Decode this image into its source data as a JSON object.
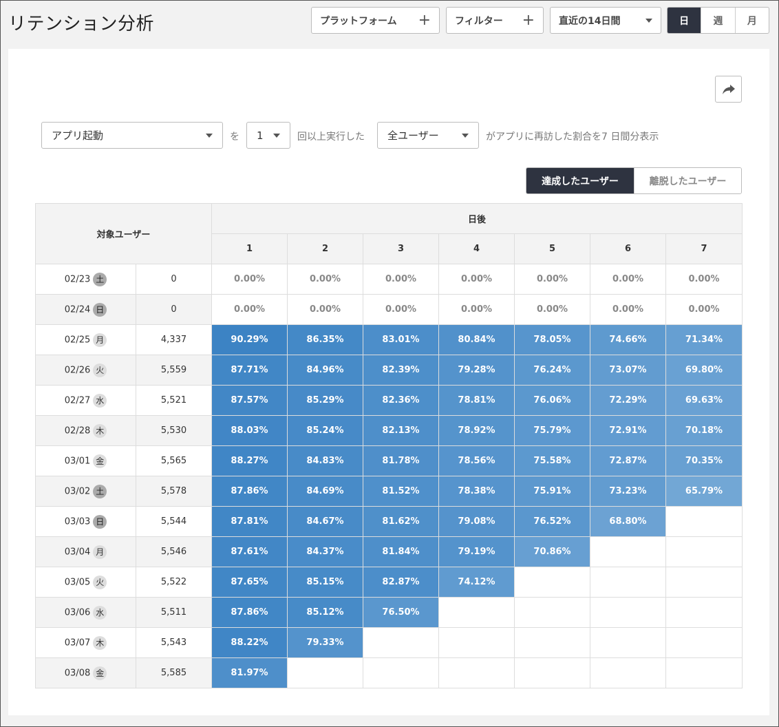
{
  "title": "リテンション分析",
  "toolbar": {
    "platform_label": "プラットフォーム",
    "filter_label": "フィルター",
    "period_label": "直近の14日間",
    "granularity": [
      "日",
      "週",
      "月"
    ],
    "granularity_active": "日"
  },
  "query": {
    "event_value": "アプリ起動",
    "text_wo": "を",
    "count_value": "1",
    "text_times": "回以上実行した",
    "segment_value": "全ユーザー",
    "text_suffix": "がアプリに再訪した割合を7 日間分表示"
  },
  "mode_toggle": {
    "achieved_label": "達成したユーザー",
    "churned_label": "離脱したユーザー",
    "active": "achieved"
  },
  "table": {
    "header_target": "対象ユーザー",
    "header_days": "日後",
    "day_columns": [
      "1",
      "2",
      "3",
      "4",
      "5",
      "6",
      "7"
    ],
    "rows": [
      {
        "date": "02/23",
        "dow": "土",
        "holiday": true,
        "count": "0",
        "values": [
          "0.00%",
          "0.00%",
          "0.00%",
          "0.00%",
          "0.00%",
          "0.00%",
          "0.00%"
        ],
        "numeric": [
          0,
          0,
          0,
          0,
          0,
          0,
          0
        ]
      },
      {
        "date": "02/24",
        "dow": "日",
        "holiday": true,
        "count": "0",
        "values": [
          "0.00%",
          "0.00%",
          "0.00%",
          "0.00%",
          "0.00%",
          "0.00%",
          "0.00%"
        ],
        "numeric": [
          0,
          0,
          0,
          0,
          0,
          0,
          0
        ]
      },
      {
        "date": "02/25",
        "dow": "月",
        "holiday": false,
        "count": "4,337",
        "values": [
          "90.29%",
          "86.35%",
          "83.01%",
          "80.84%",
          "78.05%",
          "74.66%",
          "71.34%"
        ],
        "numeric": [
          90.29,
          86.35,
          83.01,
          80.84,
          78.05,
          74.66,
          71.34
        ]
      },
      {
        "date": "02/26",
        "dow": "火",
        "holiday": false,
        "count": "5,559",
        "values": [
          "87.71%",
          "84.96%",
          "82.39%",
          "79.28%",
          "76.24%",
          "73.07%",
          "69.80%"
        ],
        "numeric": [
          87.71,
          84.96,
          82.39,
          79.28,
          76.24,
          73.07,
          69.8
        ]
      },
      {
        "date": "02/27",
        "dow": "水",
        "holiday": false,
        "count": "5,521",
        "values": [
          "87.57%",
          "85.29%",
          "82.36%",
          "78.81%",
          "76.06%",
          "72.29%",
          "69.63%"
        ],
        "numeric": [
          87.57,
          85.29,
          82.36,
          78.81,
          76.06,
          72.29,
          69.63
        ]
      },
      {
        "date": "02/28",
        "dow": "木",
        "holiday": false,
        "count": "5,530",
        "values": [
          "88.03%",
          "85.24%",
          "82.13%",
          "78.92%",
          "75.79%",
          "72.91%",
          "70.18%"
        ],
        "numeric": [
          88.03,
          85.24,
          82.13,
          78.92,
          75.79,
          72.91,
          70.18
        ]
      },
      {
        "date": "03/01",
        "dow": "金",
        "holiday": false,
        "count": "5,565",
        "values": [
          "88.27%",
          "84.83%",
          "81.78%",
          "78.56%",
          "75.58%",
          "72.87%",
          "70.35%"
        ],
        "numeric": [
          88.27,
          84.83,
          81.78,
          78.56,
          75.58,
          72.87,
          70.35
        ]
      },
      {
        "date": "03/02",
        "dow": "土",
        "holiday": true,
        "count": "5,578",
        "values": [
          "87.86%",
          "84.69%",
          "81.52%",
          "78.38%",
          "75.91%",
          "73.23%",
          "65.79%"
        ],
        "numeric": [
          87.86,
          84.69,
          81.52,
          78.38,
          75.91,
          73.23,
          65.79
        ]
      },
      {
        "date": "03/03",
        "dow": "日",
        "holiday": true,
        "count": "5,544",
        "values": [
          "87.81%",
          "84.67%",
          "81.62%",
          "79.08%",
          "76.52%",
          "68.80%",
          ""
        ],
        "numeric": [
          87.81,
          84.67,
          81.62,
          79.08,
          76.52,
          68.8,
          null
        ]
      },
      {
        "date": "03/04",
        "dow": "月",
        "holiday": false,
        "count": "5,546",
        "values": [
          "87.61%",
          "84.37%",
          "81.84%",
          "79.19%",
          "70.86%",
          "",
          ""
        ],
        "numeric": [
          87.61,
          84.37,
          81.84,
          79.19,
          70.86,
          null,
          null
        ]
      },
      {
        "date": "03/05",
        "dow": "火",
        "holiday": false,
        "count": "5,522",
        "values": [
          "87.65%",
          "85.15%",
          "82.87%",
          "74.12%",
          "",
          "",
          ""
        ],
        "numeric": [
          87.65,
          85.15,
          82.87,
          74.12,
          null,
          null,
          null
        ]
      },
      {
        "date": "03/06",
        "dow": "水",
        "holiday": false,
        "count": "5,511",
        "values": [
          "87.86%",
          "85.12%",
          "76.50%",
          "",
          "",
          "",
          ""
        ],
        "numeric": [
          87.86,
          85.12,
          76.5,
          null,
          null,
          null,
          null
        ]
      },
      {
        "date": "03/07",
        "dow": "木",
        "holiday": false,
        "count": "5,543",
        "values": [
          "88.22%",
          "79.33%",
          "",
          "",
          "",
          "",
          ""
        ],
        "numeric": [
          88.22,
          79.33,
          null,
          null,
          null,
          null,
          null
        ]
      },
      {
        "date": "03/08",
        "dow": "金",
        "holiday": false,
        "count": "5,585",
        "values": [
          "81.97%",
          "",
          "",
          "",
          "",
          "",
          ""
        ],
        "numeric": [
          81.97,
          null,
          null,
          null,
          null,
          null,
          null
        ]
      }
    ]
  },
  "colors": {
    "heat_high": "#3a82c4",
    "heat_low": "#74a8d6",
    "dark_button": "#2e3340"
  }
}
